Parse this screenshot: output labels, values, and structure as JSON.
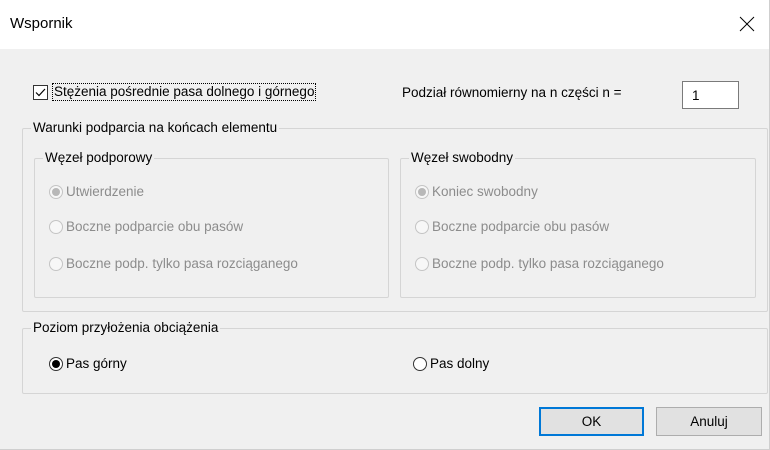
{
  "window": {
    "title": "Wspornik",
    "close_icon": "close-icon"
  },
  "bracing": {
    "checkbox_label": "Stężenia pośrednie pasa dolnego i górnego",
    "checked": true,
    "split_label": "Podział równomierny na n części n =",
    "split_value": "1"
  },
  "support_conditions": {
    "legend": "Warunki podparcia na końcach elementu",
    "support_node": {
      "legend": "Węzeł podporowy",
      "options": [
        "Utwierdzenie",
        "Boczne podparcie obu pasów",
        "Boczne podp. tylko pasa rozciąganego"
      ],
      "selected_index": 0,
      "enabled": false
    },
    "free_node": {
      "legend": "Węzeł swobodny",
      "options": [
        "Koniec swobodny",
        "Boczne podparcie obu pasów",
        "Boczne podp. tylko pasa rozciąganego"
      ],
      "selected_index": 0,
      "enabled": false
    }
  },
  "load_level": {
    "legend": "Poziom przyłożenia obciążenia",
    "options": [
      "Pas górny",
      "Pas dolny"
    ],
    "selected_index": 0
  },
  "buttons": {
    "ok": "OK",
    "cancel": "Anuluj"
  },
  "colors": {
    "default_button_border": "#0078d7",
    "title_bar": "#ffffff",
    "dialog_bg": "#f0f0f0"
  }
}
